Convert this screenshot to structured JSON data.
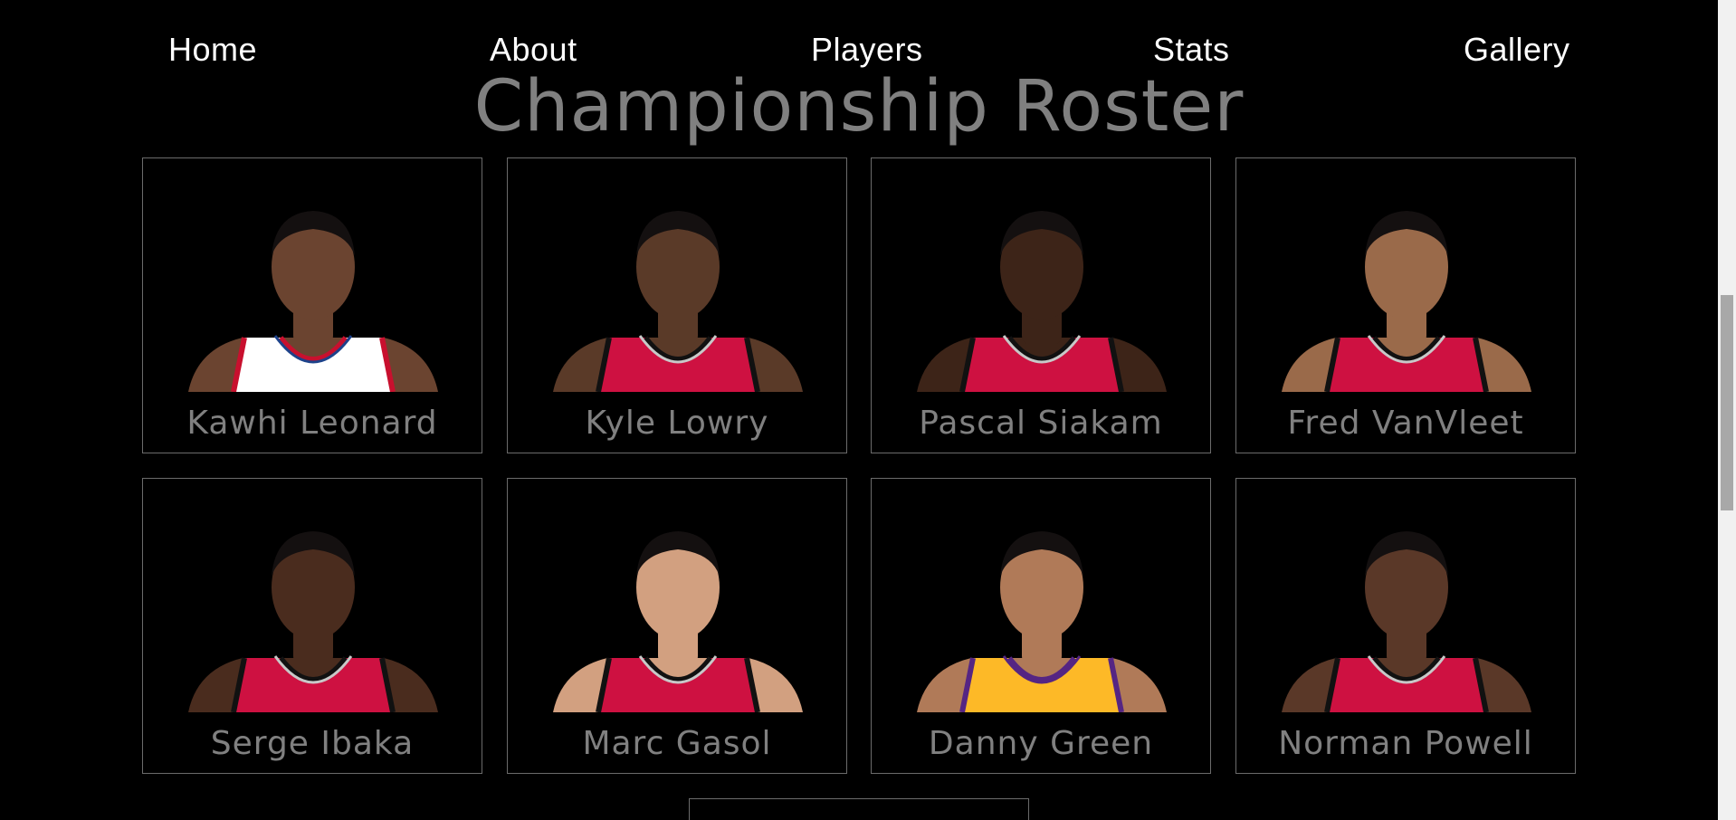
{
  "nav": {
    "items": [
      {
        "label": "Home"
      },
      {
        "label": "About"
      },
      {
        "label": "Players"
      },
      {
        "label": "Stats"
      },
      {
        "label": "Gallery"
      }
    ]
  },
  "title": "Championship Roster",
  "players": [
    {
      "name": "Kawhi Leonard",
      "jersey": "white",
      "skin": "#6b4430"
    },
    {
      "name": "Kyle Lowry",
      "jersey": "red",
      "skin": "#5a3a28"
    },
    {
      "name": "Pascal Siakam",
      "jersey": "red",
      "skin": "#3d2418"
    },
    {
      "name": "Fred VanVleet",
      "jersey": "red",
      "skin": "#9a6a4a"
    },
    {
      "name": "Serge Ibaka",
      "jersey": "red",
      "skin": "#4a2c1e"
    },
    {
      "name": "Marc Gasol",
      "jersey": "red",
      "skin": "#d2a080"
    },
    {
      "name": "Danny Green",
      "jersey": "yellow",
      "skin": "#b07a58"
    },
    {
      "name": "Norman Powell",
      "jersey": "red",
      "skin": "#5a3828"
    }
  ],
  "colors": {
    "background": "#000000",
    "title": "#808080",
    "nav_text": "#ffffff",
    "card_border": "#6b6b6b",
    "raptors_red": "#ce1141",
    "clippers_white": "#ffffff",
    "lakers_gold": "#fdb927"
  }
}
